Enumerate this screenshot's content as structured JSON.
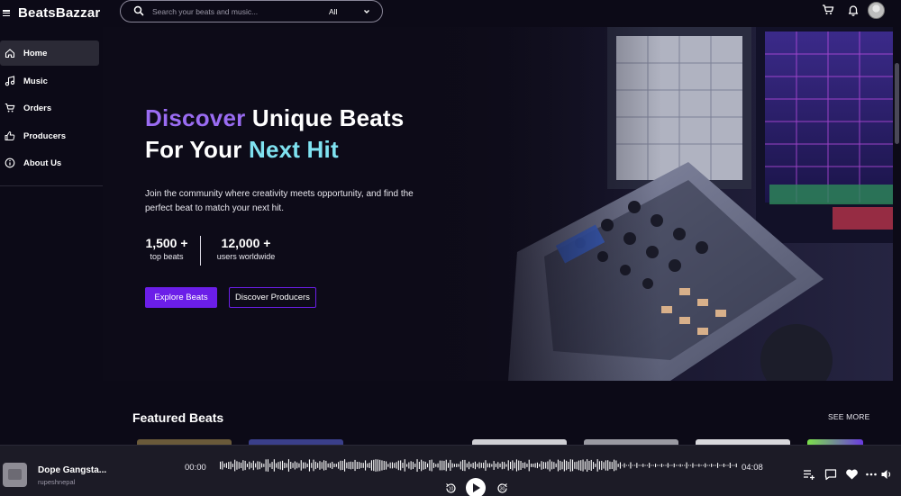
{
  "app": {
    "brand": "BeatsBazzar"
  },
  "search": {
    "placeholder": "Search your beats and music...",
    "category": "All"
  },
  "topbar": {
    "icons": [
      "cart-icon",
      "bell-icon",
      "avatar"
    ]
  },
  "sidebar": {
    "items": [
      {
        "label": "Home",
        "icon": "home-icon",
        "active": true
      },
      {
        "label": "Music",
        "icon": "music-note-icon",
        "active": false
      },
      {
        "label": "Orders",
        "icon": "cart-icon",
        "active": false
      },
      {
        "label": "Producers",
        "icon": "thumbs-up-icon",
        "active": false
      },
      {
        "label": "About Us",
        "icon": "info-icon",
        "active": false
      }
    ]
  },
  "hero": {
    "title_part1": "Discover",
    "title_part2": " Unique Beats",
    "title_part3": "For Your ",
    "title_part4": "Next Hit",
    "subtitle": "Join the community where creativity meets opportunity, and find the perfect beat to match your next hit.",
    "stats": [
      {
        "value": "1,500 +",
        "label": "top beats"
      },
      {
        "value": "12,000 +",
        "label": "users worldwide"
      }
    ],
    "cta_primary": "Explore Beats",
    "cta_secondary": "Discover Producers"
  },
  "featured": {
    "title": "Featured Beats",
    "see_more": "SEE MORE"
  },
  "player": {
    "track_title": "Dope Gangsta...",
    "artist": "rupeshnepal",
    "current_time": "00:00",
    "duration": "04:08",
    "progress": 0.0
  },
  "colors": {
    "accent": "#6b1ee8",
    "purple_text": "#9a6cf2",
    "cyan_text": "#7fe2f0",
    "background": "#0c0a17",
    "player_bg": "#1c1b26"
  }
}
